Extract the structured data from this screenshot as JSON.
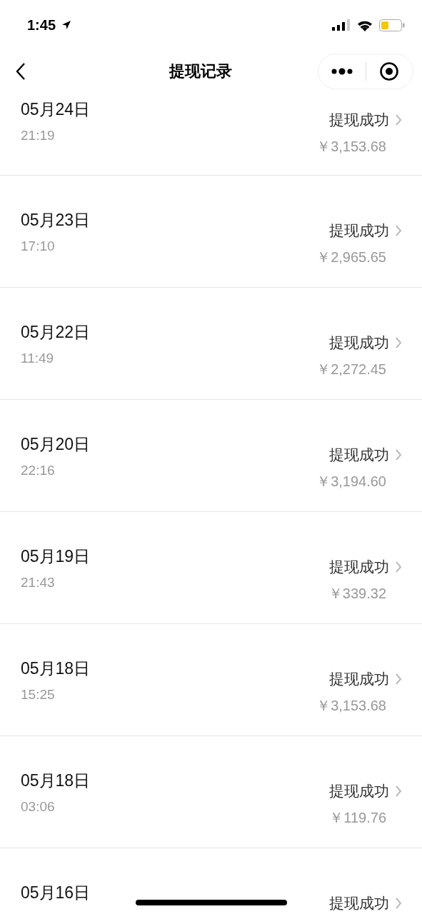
{
  "status_bar": {
    "time": "1:45"
  },
  "nav": {
    "title": "提现记录"
  },
  "records": [
    {
      "date": "05月24日",
      "time": "21:19",
      "status": "提现成功",
      "amount": "￥3,153.68"
    },
    {
      "date": "05月23日",
      "time": "17:10",
      "status": "提现成功",
      "amount": "￥2,965.65"
    },
    {
      "date": "05月22日",
      "time": "11:49",
      "status": "提现成功",
      "amount": "￥2,272.45"
    },
    {
      "date": "05月20日",
      "time": "22:16",
      "status": "提现成功",
      "amount": "￥3,194.60"
    },
    {
      "date": "05月19日",
      "time": "21:43",
      "status": "提现成功",
      "amount": "￥339.32"
    },
    {
      "date": "05月18日",
      "time": "15:25",
      "status": "提现成功",
      "amount": "￥3,153.68"
    },
    {
      "date": "05月18日",
      "time": "03:06",
      "status": "提现成功",
      "amount": "￥119.76"
    },
    {
      "date": "05月16日",
      "status": "提现成功"
    }
  ]
}
